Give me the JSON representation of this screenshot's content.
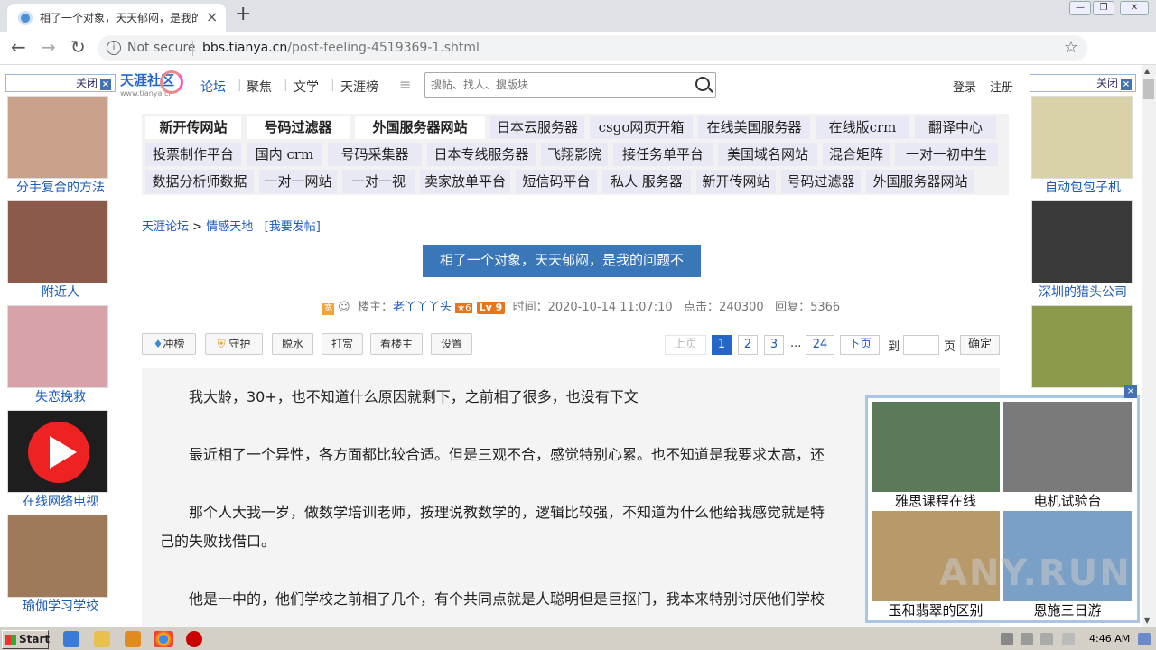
{
  "browser": {
    "tab_title": "相了一个对象，天天郁闷，是我的问题",
    "tab_close": "×",
    "new_tab": "+",
    "security_label": "Not secure",
    "url_domain": "bbs.tianya.cn",
    "url_path": "/post-feeling-4519369-1.shtml",
    "back": "←",
    "forward": "→",
    "reload": "↻",
    "star": "☆",
    "menu": "⋮"
  },
  "left_ads": {
    "close_label": "关闭",
    "close_x": "×",
    "items": [
      {
        "label": "分手复合的方法",
        "color": "#c9a08a"
      },
      {
        "label": "附近人",
        "color": "#8b5a4a"
      },
      {
        "label": "失恋挽救",
        "color": "#d8a3a8"
      },
      {
        "label": "在线网络电视",
        "color": "#1e1e1e"
      },
      {
        "label": "瑜伽学习学校",
        "color": "#9e7a5a"
      }
    ]
  },
  "right_ads": {
    "close_label": "关闭",
    "close_x": "×",
    "items": [
      {
        "label": "自动包包子机",
        "color": "#d9d2a8"
      },
      {
        "label": "深圳的猎头公司",
        "color": "#3a3a3a"
      },
      {
        "label": "",
        "color": "#8a9a4a"
      }
    ]
  },
  "header": {
    "logo_text": "天涯社区",
    "logo_sub": "www.tianya.cn",
    "nav": [
      "论坛",
      "聚焦",
      "文学",
      "天涯榜"
    ],
    "more": "≡",
    "search_placeholder": "搜帖、找人、搜版块",
    "login": "登录",
    "register": "注册"
  },
  "ad_grid": {
    "rows": [
      [
        "新开传网站",
        "号码过滤器",
        "外国服务器网站",
        "日本云服务器",
        "csgo网页开箱",
        "在线美国服务器",
        "在线版crm",
        "翻译中心"
      ],
      [
        "投票制作平台",
        "国内 crm",
        "号码采集器",
        "日本专线服务器",
        "飞翔影院",
        "接任务单平台",
        "美国域名网站",
        "混合矩阵",
        "一对一初中生"
      ],
      [
        "数据分析师数据",
        "一对一网站",
        "一对一视",
        "卖家放单平台",
        "短信码平台",
        "私人 服务器",
        "新开传网站",
        "号码过滤器",
        "外国服务器网站"
      ]
    ]
  },
  "breadcrumb": {
    "forum": "天涯论坛",
    "sep": ">",
    "board": "情感天地",
    "post_link": "[我要发帖]"
  },
  "post": {
    "title": "相了一个对象，天天郁闷，是我的问题不",
    "author_label": "楼主：",
    "author": "老丫丫丫头",
    "badge_num": "6",
    "level": "Lv 9",
    "time_label": "时间：2020-10-14 11:07:10",
    "clicks_label": "点击：240300",
    "replies_label": "回复：5366"
  },
  "actions": {
    "rank": "冲榜",
    "guard": "守护",
    "dewater": "脱水",
    "reward": "打赏",
    "view_op": "看楼主",
    "settings": "设置"
  },
  "pagination": {
    "prev": "上页",
    "pages": [
      "1",
      "2",
      "3"
    ],
    "ellipsis": "...",
    "last": "24",
    "next": "下页",
    "goto": "到",
    "page_unit": "页",
    "confirm": "确定"
  },
  "article": {
    "paragraphs": [
      "我大龄，30+，也不知道什么原因就剩下，之前相了很多，也没有下文",
      "最近相了一个异性，各方面都比较合适。但是三观不合，感觉特别心累。也不知道是我要求太高，还",
      "那个人大我一岁，做数学培训老师，按理说教数学的，逻辑比较强，不知道为什么他给我感觉就是特",
      "己的失败找借口。",
      "他是一中的，他们学校之前相了几个，有个共同点就是人聪明但是巨抠门，我本来特别讨厌他们学校"
    ]
  },
  "float_ad": {
    "close_x": "×",
    "items": [
      {
        "label": "雅思课程在线",
        "color": "#5a7a5a"
      },
      {
        "label": "电机试验台",
        "color": "#7a7a7a"
      },
      {
        "label": "玉和翡翠的区别",
        "color": "#b89a6a"
      },
      {
        "label": "恩施三日游",
        "color": "#7aa0c8"
      }
    ]
  },
  "watermark": "ANY.RUN",
  "taskbar": {
    "start": "Start",
    "clock": "4:46 AM"
  }
}
